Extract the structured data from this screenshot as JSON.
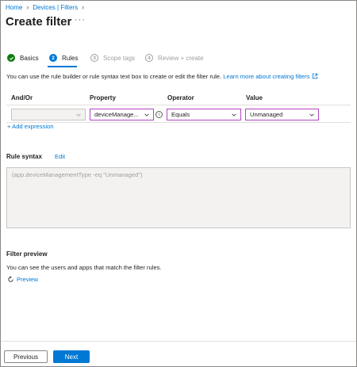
{
  "breadcrumb": {
    "home": "Home",
    "devices_filters": "Devices | Filters"
  },
  "page": {
    "title": "Create filter",
    "more": "···"
  },
  "steps": [
    {
      "number": "",
      "label": "Basics",
      "state": "done"
    },
    {
      "number": "2",
      "label": "Rules",
      "state": "active"
    },
    {
      "number": "3",
      "label": "Scope tags",
      "state": "todo"
    },
    {
      "number": "4",
      "label": "Review + create",
      "state": "todo"
    }
  ],
  "rules": {
    "description": "You can use the rule builder or rule syntax text box to create or edit the filter rule.",
    "learn_more": "Learn more about creating filters",
    "columns": {
      "and_or": "And/Or",
      "property": "Property",
      "operator": "Operator",
      "value": "Value"
    },
    "row": {
      "and_or": "",
      "property": "deviceManage...",
      "operator": "Equals",
      "value": "Unmanaged"
    },
    "info_glyph": "i",
    "add_expression": "+ Add expression"
  },
  "rule_syntax": {
    "label": "Rule syntax",
    "edit": "Edit",
    "text": "(app.deviceManagementType -eq \"Unmanaged\")"
  },
  "filter_preview": {
    "title": "Filter preview",
    "description": "You can see the users and apps that match the filter rules.",
    "preview": "Preview"
  },
  "footer": {
    "previous": "Previous",
    "next": "Next"
  },
  "colors": {
    "accent": "#0078d4",
    "success": "#107c10",
    "focus_border": "#b146c2"
  }
}
